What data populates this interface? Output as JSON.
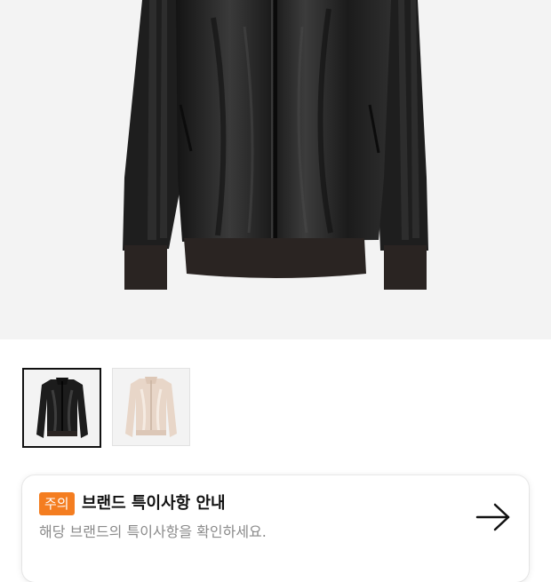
{
  "product": {
    "main_image": "black-track-jacket-image",
    "thumbnails": [
      {
        "name": "black-track-jacket-thumb",
        "selected": true
      },
      {
        "name": "beige-track-jacket-thumb",
        "selected": false
      }
    ]
  },
  "notice": {
    "badge": "주의",
    "title": "브랜드 특이사항 안내",
    "description": "해당 브랜드의 특이사항을 확인하세요.",
    "arrow_icon": "arrow-right-icon"
  },
  "colors": {
    "badge": "#f47d20",
    "image_background": "#f3f3f3",
    "jacket_black": "#1c1c1c",
    "jacket_beige": "#e8d6c8"
  }
}
